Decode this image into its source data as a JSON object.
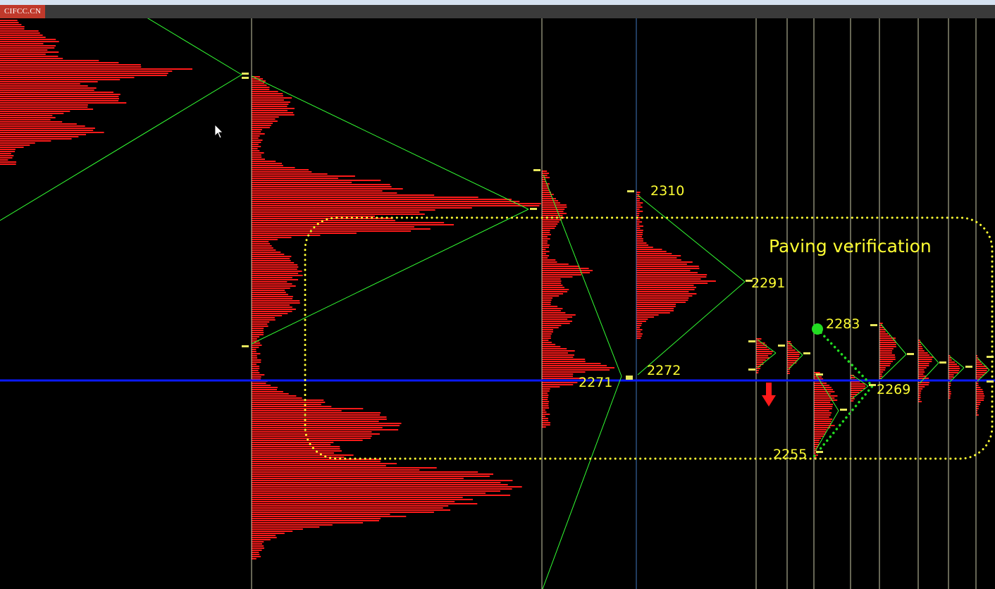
{
  "header": {
    "logo_text": "CIFCC.CN",
    "accent": "#c0392b",
    "bar_color": "#3a3a3a"
  },
  "chart_data": {
    "type": "market-profile",
    "title": "",
    "annotation": "Paving verification",
    "price_labels": [
      {
        "text": "2310"
      },
      {
        "text": "2291"
      },
      {
        "text": "2283"
      },
      {
        "text": "2272"
      },
      {
        "text": "2271"
      },
      {
        "text": "2269"
      },
      {
        "text": "2255"
      }
    ],
    "reference_price": 2271,
    "colors": {
      "profile": "#ff1a1a",
      "projection_lines": "#33ff33",
      "annotation": "#ffff33",
      "reference_line": "#0a1aff",
      "session_divider": "#f0f0c8",
      "highlight_divider": "#4a8fe0",
      "background": "#000000"
    },
    "markers": [
      {
        "name": "green-dot",
        "color": "#22dd22"
      },
      {
        "name": "down-arrow",
        "color": "#ff1a1a"
      }
    ],
    "grid": false,
    "legend": "none"
  }
}
